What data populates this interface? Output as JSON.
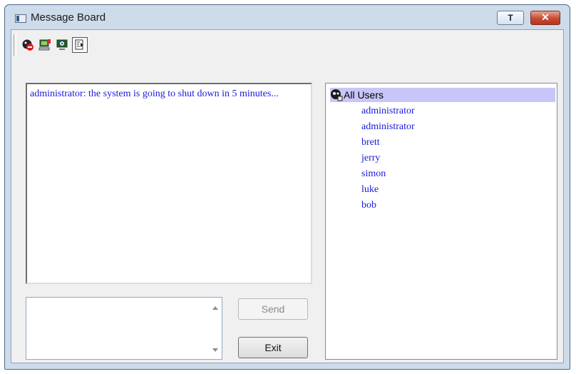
{
  "window": {
    "title": "Message Board",
    "pin_label": "T",
    "close_label": "✕"
  },
  "toolbar": {
    "tools": [
      {
        "name": "stop-user-icon",
        "pressed": false
      },
      {
        "name": "computer-icon",
        "pressed": false
      },
      {
        "name": "monitor-icon",
        "pressed": false
      },
      {
        "name": "message-view-icon",
        "pressed": true
      }
    ]
  },
  "messages": {
    "text": "administrator: the system is going to shut down in 5 minutes..."
  },
  "users": {
    "root_label": "All Users",
    "items": [
      "administrator",
      "administrator",
      "brett",
      "jerry",
      "simon",
      "luke",
      "bob"
    ]
  },
  "compose": {
    "value": ""
  },
  "buttons": {
    "send": "Send",
    "exit": "Exit"
  },
  "colors": {
    "message_text": "#1a1adc",
    "selection": "#c8c6f8",
    "frame": "#cddbea"
  }
}
